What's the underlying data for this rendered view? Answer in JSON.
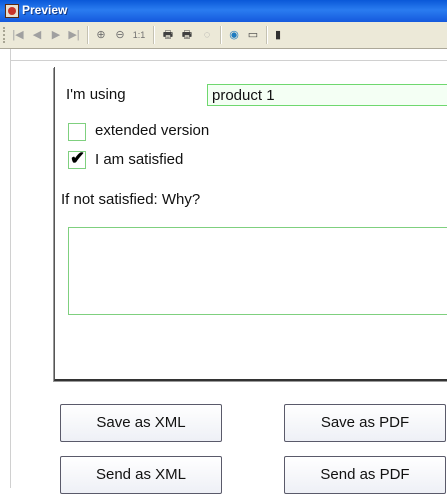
{
  "window": {
    "title": "Preview"
  },
  "toolbar": {
    "first_icon": "first-page-icon",
    "prev_icon": "previous-page-icon",
    "next_icon": "next-page-icon",
    "last_icon": "last-page-icon",
    "zoom_in_icon": "zoom-in-icon",
    "zoom_out_icon": "zoom-out-icon",
    "actual_size_label": "1:1",
    "print_icon": "print-icon",
    "print_setup_icon": "print-setup-icon",
    "export_icon": "export-icon",
    "web_icon": "web-icon",
    "window_icon": "window-icon",
    "exit_icon": "exit-icon"
  },
  "form": {
    "using_label": "I'm using",
    "product_value": "product 1",
    "extended_label": "extended version",
    "extended_checked": false,
    "satisfied_label": "I am satisfied",
    "satisfied_checked": true,
    "why_label": "If not satisfied: Why?",
    "why_value": ""
  },
  "buttons": {
    "save_xml": "Save as XML",
    "save_pdf": "Save as PDF",
    "send_xml": "Send as XML",
    "send_pdf": "Send as PDF"
  },
  "colors": {
    "field_border": "#7fd07f",
    "titlebar": "#0a58d8"
  }
}
